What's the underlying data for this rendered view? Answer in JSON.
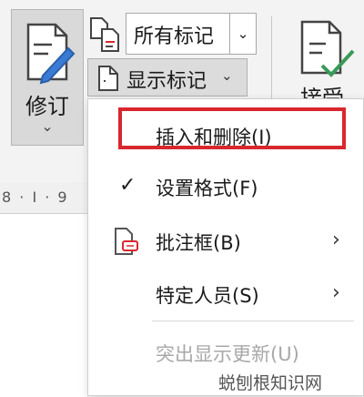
{
  "ribbon": {
    "track_changes_label": "修订",
    "track_changes_caret": "⌄",
    "markup_view_value": "所有标记",
    "markup_view_caret": "⌄",
    "show_markup_label": "显示标记",
    "show_markup_caret": "⌄",
    "accept_label": "接受"
  },
  "ruler": {
    "text": "8 · I · 9"
  },
  "menu": {
    "items": [
      {
        "label": "插入和删除(I)",
        "checked": false,
        "submenu": false,
        "disabled": false
      },
      {
        "label": "设置格式(F)",
        "checked": true,
        "check_glyph": "✓",
        "submenu": false,
        "disabled": false
      },
      {
        "label": "批注框(B)",
        "checked": false,
        "submenu": true,
        "arrow_glyph": "›",
        "icon": "balloon-icon",
        "disabled": false
      },
      {
        "label": "特定人员(S)",
        "checked": false,
        "submenu": true,
        "arrow_glyph": "›",
        "disabled": false
      },
      {
        "label": "突出显示更新(U)",
        "checked": false,
        "submenu": false,
        "disabled": true
      }
    ]
  },
  "highlight_color": "#d9272e",
  "accent_color": "#3a9a5a",
  "watermark": "蜕刨根知识网"
}
